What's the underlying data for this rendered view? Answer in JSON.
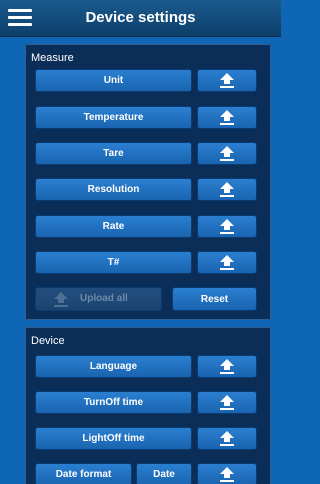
{
  "header": {
    "title": "Device settings",
    "menu_icon": "hamburger-menu-icon"
  },
  "measure": {
    "title": "Measure",
    "items": [
      {
        "label": "Unit"
      },
      {
        "label": "Temperature"
      },
      {
        "label": "Tare"
      },
      {
        "label": "Resolution"
      },
      {
        "label": "Rate"
      },
      {
        "label": "T#"
      }
    ],
    "upload_all_label": "Upload all",
    "reset_label": "Reset"
  },
  "device": {
    "title": "Device",
    "items": [
      {
        "label": "Language"
      },
      {
        "label": "TurnOff time"
      },
      {
        "label": "LightOff time"
      }
    ],
    "date_format_label": "Date format",
    "date_label": "Date"
  },
  "icons": {
    "upload": "upload-arrow-icon"
  },
  "colors": {
    "background": "#0e66b4",
    "header": "#0d3f6b",
    "panel": "#0b2e58",
    "button": "#1f6fbf",
    "button_disabled": "#1c4471",
    "text": "#ffffff"
  }
}
